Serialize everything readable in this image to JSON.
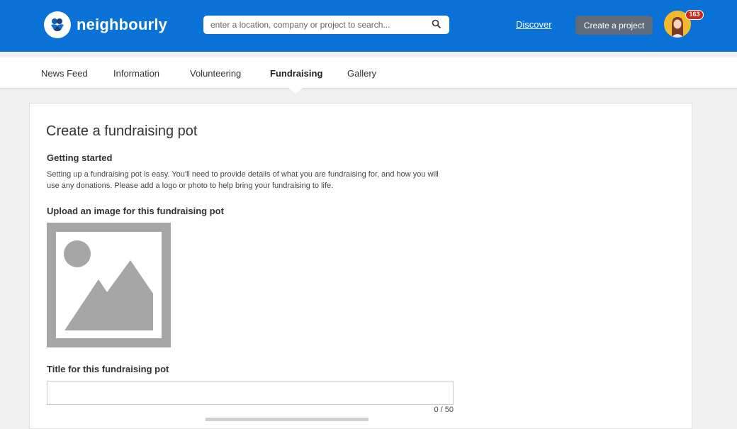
{
  "header": {
    "brand": "neighbourly",
    "search_placeholder": "enter a location, company or project to search...",
    "search_value": "",
    "discover_label": "Discover",
    "create_project_label": "Create a project",
    "notification_count": "163",
    "colors": {
      "header_bg": "#0a72d6",
      "button_bg": "#5f6b7a",
      "badge_bg": "#c8281e"
    }
  },
  "tabs": [
    {
      "label": "News Feed"
    },
    {
      "label": "Information"
    },
    {
      "label": "Volunteering"
    },
    {
      "label": "Fundraising",
      "active": true
    },
    {
      "label": "Gallery"
    }
  ],
  "form": {
    "title": "Create a fundraising pot",
    "getting_started_heading": "Getting started",
    "getting_started_text": "Setting up a fundraising pot is easy. You'll need to provide details of what you are fundraising for, and how you will use any donations. Please add a logo or photo to help bring your fundraising to life.",
    "upload_heading": "Upload an image for this fundraising pot",
    "title_field_label": "Title for this fundraising pot",
    "title_field_value": "",
    "title_counter": "0 / 50"
  },
  "icons": {
    "logo": "neighbourly-logo-icon",
    "search": "search-icon",
    "upload_placeholder": "image-placeholder-icon",
    "avatar": "user-avatar"
  }
}
